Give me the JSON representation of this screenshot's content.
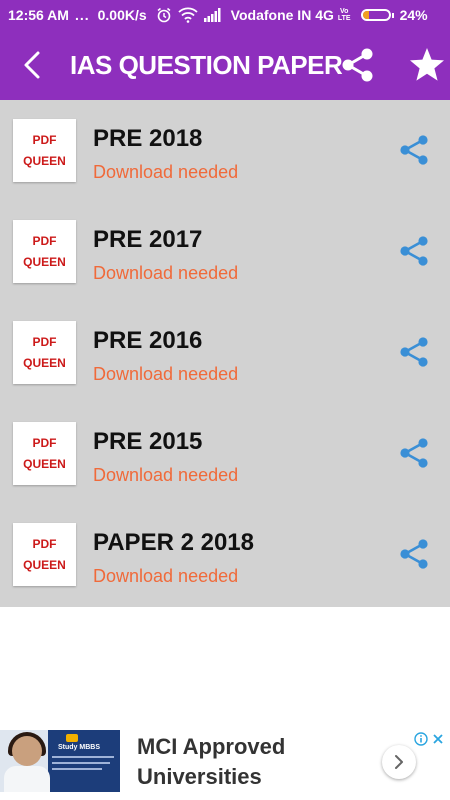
{
  "status_bar": {
    "time": "12:56 AM",
    "dots": "...",
    "speed": "0.00K/s",
    "carrier": "Vodafone IN 4G",
    "volte_top": "Vo",
    "volte_bottom": "LTE",
    "battery_percent": "24%",
    "battery_level": 0.24,
    "icons": [
      "alarm-icon",
      "wifi-icon",
      "signal-icon",
      "volte-icon",
      "battery-icon"
    ]
  },
  "toolbar": {
    "title": "IAS QUESTION PAPER",
    "icons": [
      "back-arrow-icon",
      "share-icon",
      "star-icon"
    ],
    "background": "#8e2fbd"
  },
  "list": {
    "background": "#d2d2d2",
    "items": [
      {
        "thumb_line1": "PDF",
        "thumb_line2": "QUEEN",
        "title": "PRE 2018",
        "subtitle": "Download needed"
      },
      {
        "thumb_line1": "PDF",
        "thumb_line2": "QUEEN",
        "title": "PRE 2017",
        "subtitle": "Download needed"
      },
      {
        "thumb_line1": "PDF",
        "thumb_line2": "QUEEN",
        "title": "PRE 2016",
        "subtitle": "Download needed"
      },
      {
        "thumb_line1": "PDF",
        "thumb_line2": "QUEEN",
        "title": "PRE 2015",
        "subtitle": "Download needed"
      },
      {
        "thumb_line1": "PDF",
        "thumb_line2": "QUEEN",
        "title": "PAPER 2 2018",
        "subtitle": "Download needed"
      }
    ],
    "subtitle_color": "#f06a3a",
    "share_icon_color": "#3a8fd6"
  },
  "ad": {
    "image_label": "Study MBBS",
    "line1": "MCI Approved",
    "line2": "Universities",
    "icons": [
      "ad-info-icon",
      "ad-close-icon",
      "chevron-right-icon"
    ]
  }
}
